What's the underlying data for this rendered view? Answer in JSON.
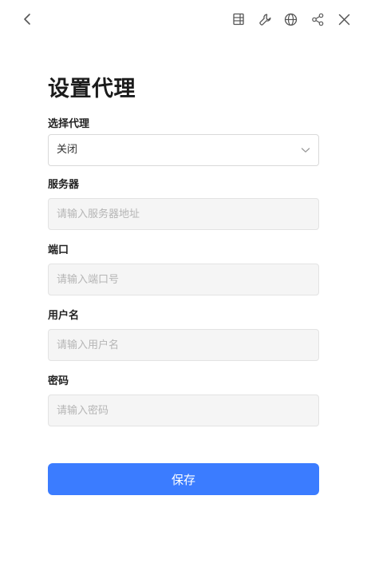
{
  "toolbar": {
    "back_icon": "chevron-left-icon",
    "icons": [
      "layout-panel-icon",
      "wrench-icon",
      "globe-icon",
      "share-icon",
      "close-icon"
    ]
  },
  "page": {
    "title": "设置代理"
  },
  "proxy_select": {
    "label": "选择代理",
    "value": "关闭"
  },
  "server": {
    "label": "服务器",
    "placeholder": "请输入服务器地址"
  },
  "port": {
    "label": "端口",
    "placeholder": "请输入端口号"
  },
  "username": {
    "label": "用户名",
    "placeholder": "请输入用户名"
  },
  "password": {
    "label": "密码",
    "placeholder": "请输入密码"
  },
  "actions": {
    "save_label": "保存"
  },
  "colors": {
    "accent": "#3b7cff",
    "input_bg": "#f5f5f5",
    "border": "#d9d9d9"
  }
}
